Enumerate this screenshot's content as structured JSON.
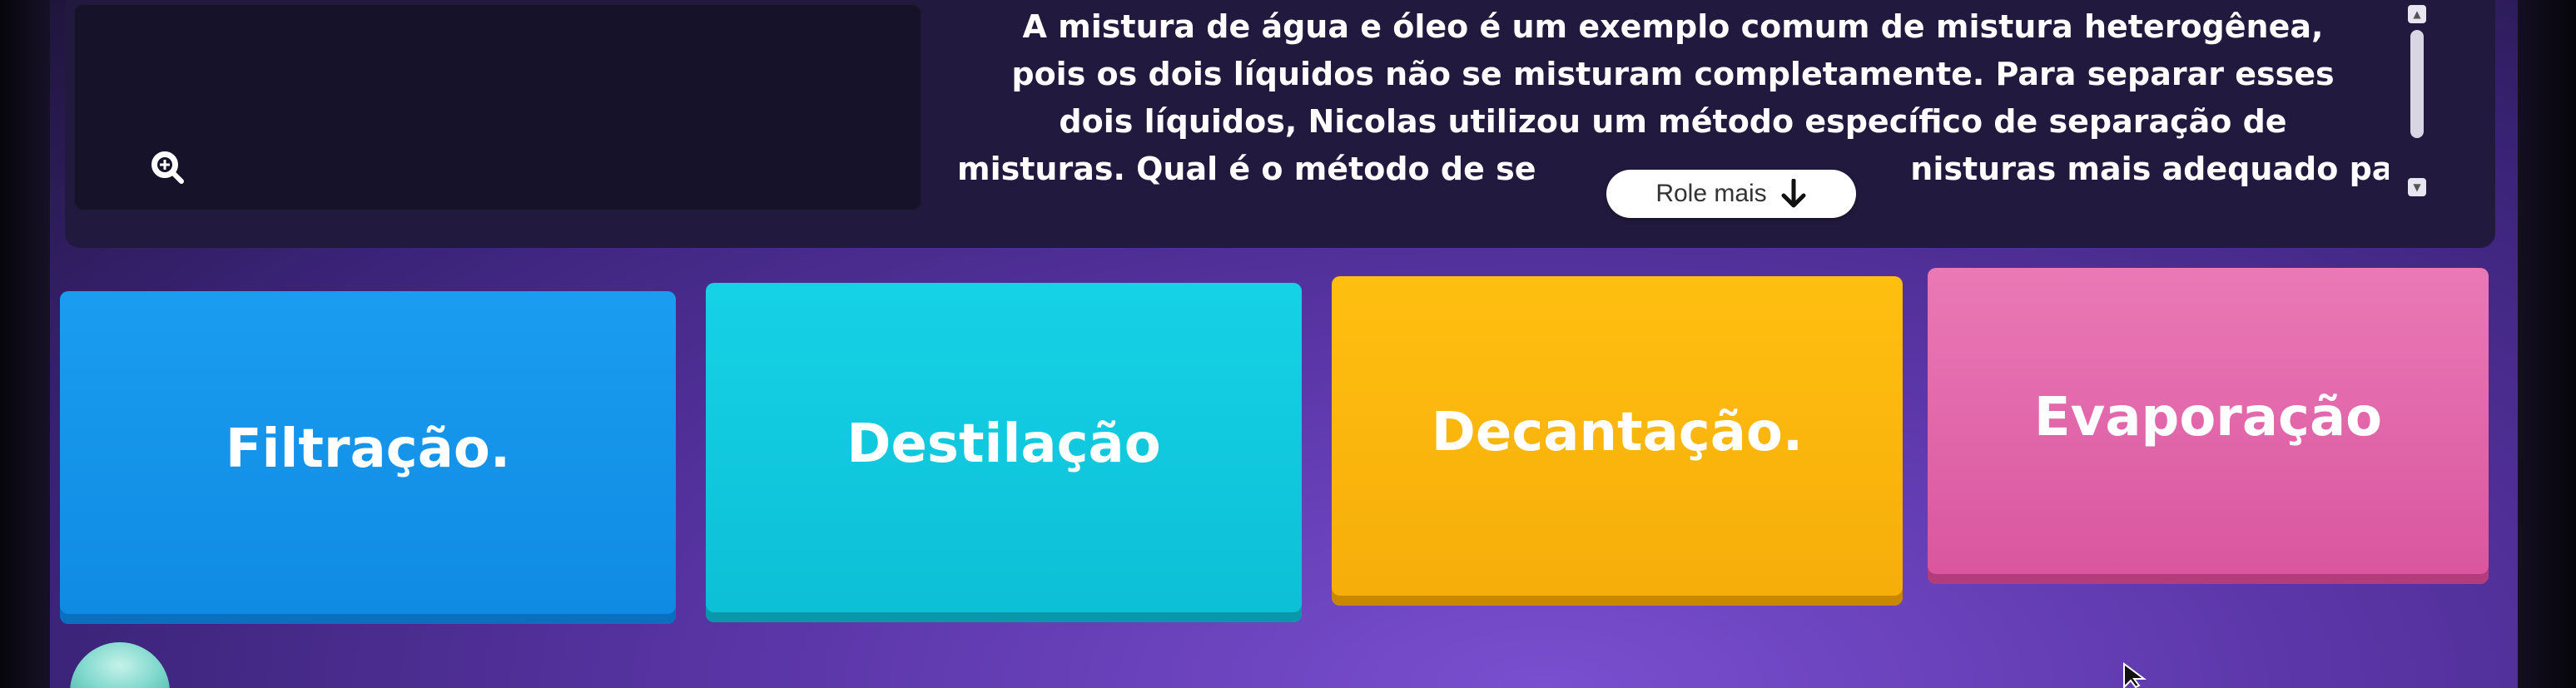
{
  "question": {
    "line1": "A mistura de água e óleo é um exemplo comum de mistura heterogênea,",
    "line2": "pois os dois líquidos não se misturam completamente. Para separar esses",
    "line3": "dois líquidos, Nicolas utilizou um método específico de separação de",
    "line4": "misturas. Qual é o método de se                                  nisturas mais adequado para"
  },
  "read_more": {
    "label": "Role mais"
  },
  "answers": [
    {
      "label": "Filtração.",
      "color": "#1a9df0"
    },
    {
      "label": "Destilação",
      "color": "#16d2e6"
    },
    {
      "label": "Decantação.",
      "color": "#ffbf10"
    },
    {
      "label": "Evaporação",
      "color": "#ea79b6"
    }
  ],
  "icons": {
    "zoom": "zoom-in-icon",
    "read_more_arrow": "arrow-down-icon",
    "cursor": "mouse-cursor-icon"
  },
  "colors": {
    "background": "#5b36a8",
    "question_panel": "#221a3e",
    "media_box": "#16122a"
  }
}
